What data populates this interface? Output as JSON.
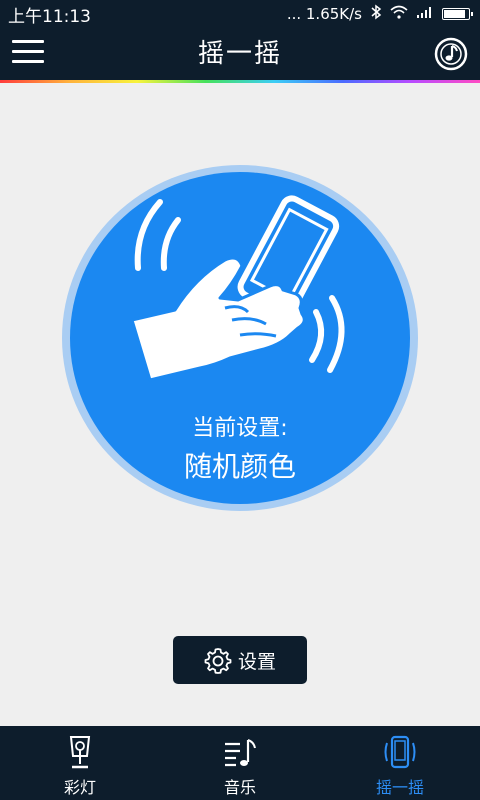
{
  "status_bar": {
    "time": "上午11:13",
    "speed": "... 1.65K/s",
    "battery_level": 0.9
  },
  "header": {
    "title": "摇一摇"
  },
  "shake": {
    "current_label": "当前设置:",
    "current_value": "随机颜色"
  },
  "settings_button": {
    "label": "设置"
  },
  "nav": {
    "items": [
      {
        "label": "彩灯",
        "icon": "lamp-icon",
        "active": false
      },
      {
        "label": "音乐",
        "icon": "music-list-icon",
        "active": false
      },
      {
        "label": "摇一摇",
        "icon": "shake-phone-icon",
        "active": true
      }
    ]
  },
  "colors": {
    "bar_background": "#0d1d2c",
    "circle_blue": "#1b88f1",
    "halo_blue": "#a9cdf3",
    "active_nav": "#2d8ef5",
    "page_background": "#efefef"
  }
}
